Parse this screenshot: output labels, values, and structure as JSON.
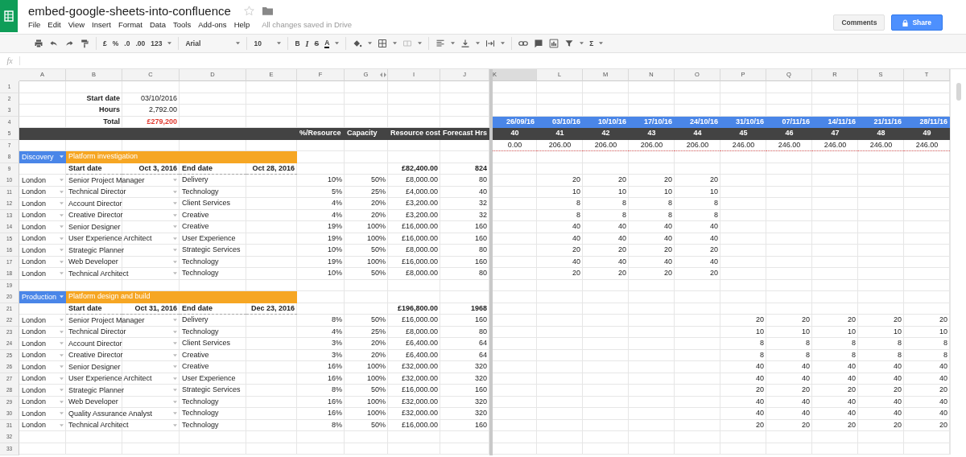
{
  "app": {
    "title": "embed-google-sheets-into-confluence",
    "starred": false,
    "menu": [
      "File",
      "Edit",
      "View",
      "Insert",
      "Format",
      "Data",
      "Tools",
      "Add-ons",
      "Help"
    ],
    "save_status": "All changes saved in Drive",
    "comments_button": "Comments",
    "share_button": "Share"
  },
  "toolbar": [
    [
      {
        "kind": "print",
        "dropdown": false
      },
      {
        "kind": "undo",
        "dropdown": false
      },
      {
        "kind": "redo",
        "dropdown": false
      },
      {
        "kind": "paint",
        "dropdown": false
      }
    ],
    [
      {
        "kind": "text",
        "text": "£",
        "dropdown": false
      },
      {
        "kind": "text",
        "text": "%",
        "dropdown": false
      },
      {
        "kind": "text",
        "text": ".0",
        "dropdown": false
      },
      {
        "kind": "text",
        "text": ".00",
        "dropdown": false
      },
      {
        "kind": "text",
        "text": "123",
        "dropdown": true
      }
    ],
    [
      {
        "kind": "font",
        "text": "Arial",
        "dropdown": true
      }
    ],
    [
      {
        "kind": "size",
        "text": "10",
        "dropdown": true
      }
    ],
    [
      {
        "kind": "bold",
        "text": "B",
        "dropdown": false
      },
      {
        "kind": "italic",
        "text": "I",
        "dropdown": false
      },
      {
        "kind": "strike",
        "text": "S",
        "dropdown": false
      },
      {
        "kind": "color",
        "text": "A",
        "dropdown": true
      }
    ],
    [
      {
        "kind": "fill",
        "dropdown": true
      },
      {
        "kind": "borders",
        "dropdown": true
      },
      {
        "kind": "merge",
        "dropdown": true
      }
    ],
    [
      {
        "kind": "align",
        "dropdown": true
      },
      {
        "kind": "valign",
        "dropdown": true
      },
      {
        "kind": "wrap",
        "dropdown": true
      }
    ],
    [
      {
        "kind": "link",
        "dropdown": false
      },
      {
        "kind": "comment",
        "dropdown": false
      },
      {
        "kind": "chart",
        "dropdown": false
      },
      {
        "kind": "filter",
        "dropdown": true
      },
      {
        "kind": "text",
        "text": "Σ",
        "dropdown": true
      }
    ]
  ],
  "formula_bar": {
    "label": "fx"
  },
  "columns": [
    {
      "label": "A",
      "selected": false,
      "hidden_after": false
    },
    {
      "label": "B",
      "selected": false,
      "hidden_after": false
    },
    {
      "label": "C",
      "selected": false,
      "hidden_after": false
    },
    {
      "label": "D",
      "selected": false,
      "hidden_after": false
    },
    {
      "label": "E",
      "selected": false,
      "hidden_after": false
    },
    {
      "label": "F",
      "selected": false,
      "hidden_after": false
    },
    {
      "label": "G",
      "selected": false,
      "hidden_after": true
    },
    {
      "label": "I",
      "selected": false,
      "hidden_after": false
    },
    {
      "label": "J",
      "selected": false,
      "hidden_after": false
    },
    {
      "label": "K",
      "selected": true,
      "hidden_after": false
    },
    {
      "label": "L",
      "selected": false,
      "hidden_after": false
    },
    {
      "label": "M",
      "selected": false,
      "hidden_after": false
    },
    {
      "label": "N",
      "selected": false,
      "hidden_after": false
    },
    {
      "label": "O",
      "selected": false,
      "hidden_after": false
    },
    {
      "label": "P",
      "selected": false,
      "hidden_after": false
    },
    {
      "label": "Q",
      "selected": false,
      "hidden_after": false
    },
    {
      "label": "R",
      "selected": false,
      "hidden_after": false
    },
    {
      "label": "S",
      "selected": false,
      "hidden_after": false
    },
    {
      "label": "T",
      "selected": false,
      "hidden_after": false
    }
  ],
  "rows": [
    {
      "number": "1",
      "kind": "blank"
    },
    {
      "number": "2",
      "kind": "summary",
      "label": "Start date",
      "value": "03/10/2016",
      "alert": false
    },
    {
      "number": "3",
      "kind": "summary",
      "label": "Hours",
      "value": "2,792.00",
      "alert": false
    },
    {
      "number": "4",
      "kind": "summary",
      "label": "Total",
      "value": "£279,200",
      "alert": true,
      "weeks": [
        "26/09/16",
        "03/10/16",
        "10/10/16",
        "17/10/16",
        "24/10/16",
        "31/10/16",
        "07/11/16",
        "14/11/16",
        "21/11/16",
        "28/11/16"
      ]
    },
    {
      "number": "5",
      "kind": "columns",
      "headings": [
        "%/Resource",
        "Capacity",
        "Resource cost",
        "Forecast Hrs"
      ],
      "weeks": [
        "40",
        "41",
        "42",
        "43",
        "44",
        "45",
        "46",
        "47",
        "48",
        "49"
      ]
    },
    {
      "number": "7",
      "kind": "totals",
      "weeks": [
        "0.00",
        "206.00",
        "206.00",
        "206.00",
        "206.00",
        "246.00",
        "246.00",
        "246.00",
        "246.00",
        "246.00"
      ]
    },
    {
      "number": "8",
      "kind": "phase",
      "phase": "Discovery",
      "title": "Platform investigation"
    },
    {
      "number": "9",
      "kind": "dates",
      "start_label": "Start date",
      "start": "Oct 3, 2016",
      "end_label": "End date",
      "end": "Oct 28, 2016",
      "cost": "£82,400.00",
      "hours": "824"
    },
    {
      "number": "10",
      "kind": "resource",
      "location": "London",
      "role": "Senior Project Manager",
      "department": "Delivery",
      "share": "10%",
      "capacity": "50%",
      "cost": "£8,000.00",
      "hours": "80",
      "weeks": {
        "week_2": "20",
        "week_3": "20",
        "week_4": "20",
        "week_5": "20"
      }
    },
    {
      "number": "11",
      "kind": "resource",
      "location": "London",
      "role": "Technical Director",
      "department": "Technology",
      "share": "5%",
      "capacity": "25%",
      "cost": "£4,000.00",
      "hours": "40",
      "weeks": {
        "week_2": "10",
        "week_3": "10",
        "week_4": "10",
        "week_5": "10"
      }
    },
    {
      "number": "12",
      "kind": "resource",
      "location": "London",
      "role": "Account Director",
      "department": "Client Services",
      "share": "4%",
      "capacity": "20%",
      "cost": "£3,200.00",
      "hours": "32",
      "weeks": {
        "week_2": "8",
        "week_3": "8",
        "week_4": "8",
        "week_5": "8"
      }
    },
    {
      "number": "13",
      "kind": "resource",
      "location": "London",
      "role": "Creative Director",
      "department": "Creative",
      "share": "4%",
      "capacity": "20%",
      "cost": "£3,200.00",
      "hours": "32",
      "weeks": {
        "week_2": "8",
        "week_3": "8",
        "week_4": "8",
        "week_5": "8"
      }
    },
    {
      "number": "14",
      "kind": "resource",
      "location": "London",
      "role": "Senior Designer",
      "department": "Creative",
      "share": "19%",
      "capacity": "100%",
      "cost": "£16,000.00",
      "hours": "160",
      "weeks": {
        "week_2": "40",
        "week_3": "40",
        "week_4": "40",
        "week_5": "40"
      }
    },
    {
      "number": "15",
      "kind": "resource",
      "location": "London",
      "role": "User Experience Architect",
      "department": "User Experience",
      "share": "19%",
      "capacity": "100%",
      "cost": "£16,000.00",
      "hours": "160",
      "weeks": {
        "week_2": "40",
        "week_3": "40",
        "week_4": "40",
        "week_5": "40"
      }
    },
    {
      "number": "16",
      "kind": "resource",
      "location": "London",
      "role": "Strategic Planner",
      "department": "Strategic Services",
      "share": "10%",
      "capacity": "50%",
      "cost": "£8,000.00",
      "hours": "80",
      "weeks": {
        "week_2": "20",
        "week_3": "20",
        "week_4": "20",
        "week_5": "20"
      }
    },
    {
      "number": "17",
      "kind": "resource",
      "location": "London",
      "role": "Web Developer",
      "department": "Technology",
      "share": "19%",
      "capacity": "100%",
      "cost": "£16,000.00",
      "hours": "160",
      "weeks": {
        "week_2": "40",
        "week_3": "40",
        "week_4": "40",
        "week_5": "40"
      }
    },
    {
      "number": "18",
      "kind": "resource",
      "location": "London",
      "role": "Technical Architect",
      "department": "Technology",
      "share": "10%",
      "capacity": "50%",
      "cost": "£8,000.00",
      "hours": "80",
      "weeks": {
        "week_2": "20",
        "week_3": "20",
        "week_4": "20",
        "week_5": "20"
      }
    },
    {
      "number": "19",
      "kind": "blank"
    },
    {
      "number": "20",
      "kind": "phase",
      "phase": "Production",
      "title": "Platform design and build"
    },
    {
      "number": "21",
      "kind": "dates",
      "start_label": "Start date",
      "start": "Oct 31, 2016",
      "end_label": "End date",
      "end": "Dec 23, 2016",
      "cost": "£196,800.00",
      "hours": "1968"
    },
    {
      "number": "22",
      "kind": "resource",
      "location": "London",
      "role": "Senior Project Manager",
      "department": "Delivery",
      "share": "8%",
      "capacity": "50%",
      "cost": "£16,000.00",
      "hours": "160",
      "weeks": {
        "week_6": "20",
        "week_7": "20",
        "week_8": "20",
        "week_9": "20",
        "week_10": "20"
      }
    },
    {
      "number": "23",
      "kind": "resource",
      "location": "London",
      "role": "Technical Director",
      "department": "Technology",
      "share": "4%",
      "capacity": "25%",
      "cost": "£8,000.00",
      "hours": "80",
      "weeks": {
        "week_6": "10",
        "week_7": "10",
        "week_8": "10",
        "week_9": "10",
        "week_10": "10"
      }
    },
    {
      "number": "24",
      "kind": "resource",
      "location": "London",
      "role": "Account Director",
      "department": "Client Services",
      "share": "3%",
      "capacity": "20%",
      "cost": "£6,400.00",
      "hours": "64",
      "weeks": {
        "week_6": "8",
        "week_7": "8",
        "week_8": "8",
        "week_9": "8",
        "week_10": "8"
      }
    },
    {
      "number": "25",
      "kind": "resource",
      "location": "London",
      "role": "Creative Director",
      "department": "Creative",
      "share": "3%",
      "capacity": "20%",
      "cost": "£6,400.00",
      "hours": "64",
      "weeks": {
        "week_6": "8",
        "week_7": "8",
        "week_8": "8",
        "week_9": "8",
        "week_10": "8"
      }
    },
    {
      "number": "26",
      "kind": "resource",
      "location": "London",
      "role": "Senior Designer",
      "department": "Creative",
      "share": "16%",
      "capacity": "100%",
      "cost": "£32,000.00",
      "hours": "320",
      "weeks": {
        "week_6": "40",
        "week_7": "40",
        "week_8": "40",
        "week_9": "40",
        "week_10": "40"
      }
    },
    {
      "number": "27",
      "kind": "resource",
      "location": "London",
      "role": "User Experience Architect",
      "department": "User Experience",
      "share": "16%",
      "capacity": "100%",
      "cost": "£32,000.00",
      "hours": "320",
      "weeks": {
        "week_6": "40",
        "week_7": "40",
        "week_8": "40",
        "week_9": "40",
        "week_10": "40"
      }
    },
    {
      "number": "28",
      "kind": "resource",
      "location": "London",
      "role": "Strategic Planner",
      "department": "Strategic Services",
      "share": "8%",
      "capacity": "50%",
      "cost": "£16,000.00",
      "hours": "160",
      "weeks": {
        "week_6": "20",
        "week_7": "20",
        "week_8": "20",
        "week_9": "20",
        "week_10": "20"
      }
    },
    {
      "number": "29",
      "kind": "resource",
      "location": "London",
      "role": "Web Developer",
      "department": "Technology",
      "share": "16%",
      "capacity": "100%",
      "cost": "£32,000.00",
      "hours": "320",
      "weeks": {
        "week_6": "40",
        "week_7": "40",
        "week_8": "40",
        "week_9": "40",
        "week_10": "40"
      }
    },
    {
      "number": "30",
      "kind": "resource",
      "location": "London",
      "role": "Quality Assurance Analyst",
      "department": "Technology",
      "share": "16%",
      "capacity": "100%",
      "cost": "£32,000.00",
      "hours": "320",
      "weeks": {
        "week_6": "40",
        "week_7": "40",
        "week_8": "40",
        "week_9": "40",
        "week_10": "40"
      }
    },
    {
      "number": "31",
      "kind": "resource",
      "location": "London",
      "role": "Technical Architect",
      "department": "Technology",
      "share": "8%",
      "capacity": "50%",
      "cost": "£16,000.00",
      "hours": "160",
      "weeks": {
        "week_6": "20",
        "week_7": "20",
        "week_8": "20",
        "week_9": "20",
        "week_10": "20"
      }
    },
    {
      "number": "32",
      "kind": "blank"
    },
    {
      "number": "33",
      "kind": "blank"
    }
  ]
}
